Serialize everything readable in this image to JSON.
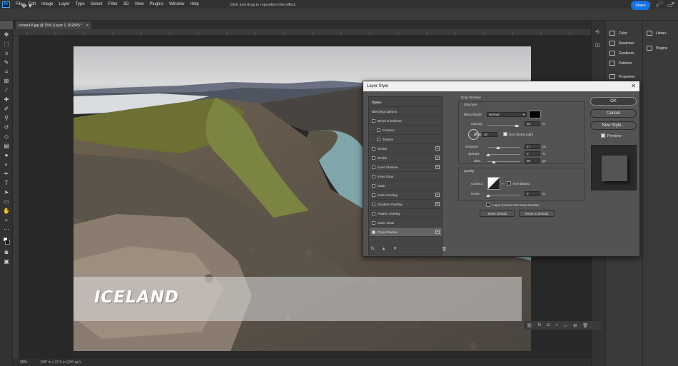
{
  "app": {
    "logo": "Ps"
  },
  "menu": [
    "File",
    "Edit",
    "Image",
    "Layer",
    "Type",
    "Select",
    "Filter",
    "3D",
    "View",
    "Plugins",
    "Window",
    "Help"
  ],
  "window_controls": [
    "—",
    "□",
    "✕"
  ],
  "options_bar": {
    "hint": "Click and drag to reposition this effect.",
    "share_label": "Share"
  },
  "document": {
    "tab_title": "Iceland-8.jpg @ 25% (Layer 1, RGB/8) *",
    "tab_close": "×",
    "zoom": "25%",
    "info": "168* in x 37.6 in (300 ppi)",
    "banner_text": "ICELAND"
  },
  "panels": {
    "right1": [
      {
        "label": "Color",
        "icon": "color-wheel-icon"
      },
      {
        "label": "Swatches",
        "icon": "swatches-icon"
      },
      {
        "label": "Gradients",
        "icon": "gradients-icon"
      },
      {
        "label": "Patterns",
        "icon": "patterns-icon"
      },
      {
        "label": "Properties",
        "icon": "properties-icon"
      }
    ],
    "right2": [
      {
        "label": "Librari...",
        "icon": "libraries-icon"
      },
      {
        "label": "Plugins",
        "icon": "plugins-icon"
      }
    ]
  },
  "layer_style": {
    "title": "Layer Style",
    "close": "✕",
    "list_header": "Styles",
    "items": [
      {
        "label": "Blending Options",
        "checkbox": false,
        "plus": false
      },
      {
        "label": "Bevel & Emboss",
        "checkbox": true,
        "plus": false
      },
      {
        "label": "Contour",
        "checkbox": true,
        "plus": false,
        "indent": true
      },
      {
        "label": "Texture",
        "checkbox": true,
        "plus": false,
        "indent": true
      },
      {
        "label": "Stroke",
        "checkbox": true,
        "plus": true
      },
      {
        "label": "Stroke",
        "checkbox": true,
        "plus": true
      },
      {
        "label": "Inner Shadow",
        "checkbox": true,
        "plus": true
      },
      {
        "label": "Inner Glow",
        "checkbox": true,
        "plus": false
      },
      {
        "label": "Satin",
        "checkbox": true,
        "plus": false
      },
      {
        "label": "Color Overlay",
        "checkbox": true,
        "plus": true
      },
      {
        "label": "Gradient Overlay",
        "checkbox": true,
        "plus": true
      },
      {
        "label": "Pattern Overlay",
        "checkbox": true,
        "plus": false
      },
      {
        "label": "Outer Glow",
        "checkbox": true,
        "plus": false
      },
      {
        "label": "Drop Shadow",
        "checkbox": true,
        "plus": true,
        "selected": true
      }
    ],
    "footer": {
      "fx": "fx",
      "up": "▲",
      "down": "▼",
      "trash": "🗑"
    },
    "drop_shadow": {
      "section": "Drop Shadow",
      "structure": "Structure",
      "blend_mode_label": "Blend Mode:",
      "blend_mode_value": "Normal",
      "opacity_label": "Opacity:",
      "opacity_value": "35",
      "angle_label": "Angle:",
      "angle_value": "30",
      "global_light": "Use Global Light",
      "distance_label": "Distance:",
      "distance_value": "17",
      "spread_label": "Spread:",
      "spread_value": "0",
      "size_label": "Size:",
      "size_value": "38",
      "px": "px",
      "pct": "%",
      "deg": "°",
      "quality": "Quality",
      "contour_label": "Contour:",
      "antialiased": "Anti-aliased",
      "noise_label": "Noise:",
      "noise_value": "0",
      "knockout": "Layer Knocks Out Drop Shadow",
      "make_default": "Make Default",
      "reset_default": "Reset to Default"
    },
    "buttons": {
      "ok": "OK",
      "cancel": "Cancel",
      "new_style": "New Style...",
      "preview": "Preview"
    }
  }
}
